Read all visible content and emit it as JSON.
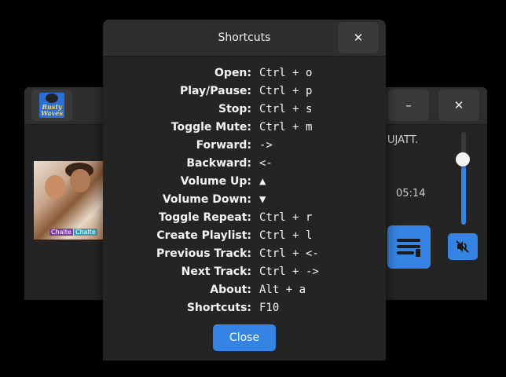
{
  "player": {
    "logo_line1": "Rusty",
    "logo_line2": "Waves",
    "minimize_glyph": "–",
    "close_glyph": "✕",
    "album_tag1": "Chalte",
    "album_tag2": "Chalte",
    "track_title": "UJATT.",
    "track_time": "05:14",
    "volume_level": 0.7,
    "accent": "#3584e4"
  },
  "dialog": {
    "title": "Shortcuts",
    "close_glyph": "✕",
    "close_button_label": "Close",
    "shortcuts": [
      {
        "label": "Open:",
        "keys": "Ctrl + o"
      },
      {
        "label": "Play/Pause:",
        "keys": "Ctrl + p"
      },
      {
        "label": "Stop:",
        "keys": "Ctrl + s"
      },
      {
        "label": "Toggle Mute:",
        "keys": "Ctrl + m"
      },
      {
        "label": "Forward:",
        "keys": "->"
      },
      {
        "label": "Backward:",
        "keys": "<-"
      },
      {
        "label": "Volume Up:",
        "keys": "▲"
      },
      {
        "label": "Volume Down:",
        "keys": "▼"
      },
      {
        "label": "Toggle Repeat:",
        "keys": "Ctrl + r"
      },
      {
        "label": "Create Playlist:",
        "keys": "Ctrl + l"
      },
      {
        "label": "Previous Track:",
        "keys": "Ctrl + <-"
      },
      {
        "label": "Next Track:",
        "keys": "Ctrl + ->"
      },
      {
        "label": "About:",
        "keys": "Alt + a"
      },
      {
        "label": "Shortcuts:",
        "keys": "F10"
      }
    ]
  }
}
